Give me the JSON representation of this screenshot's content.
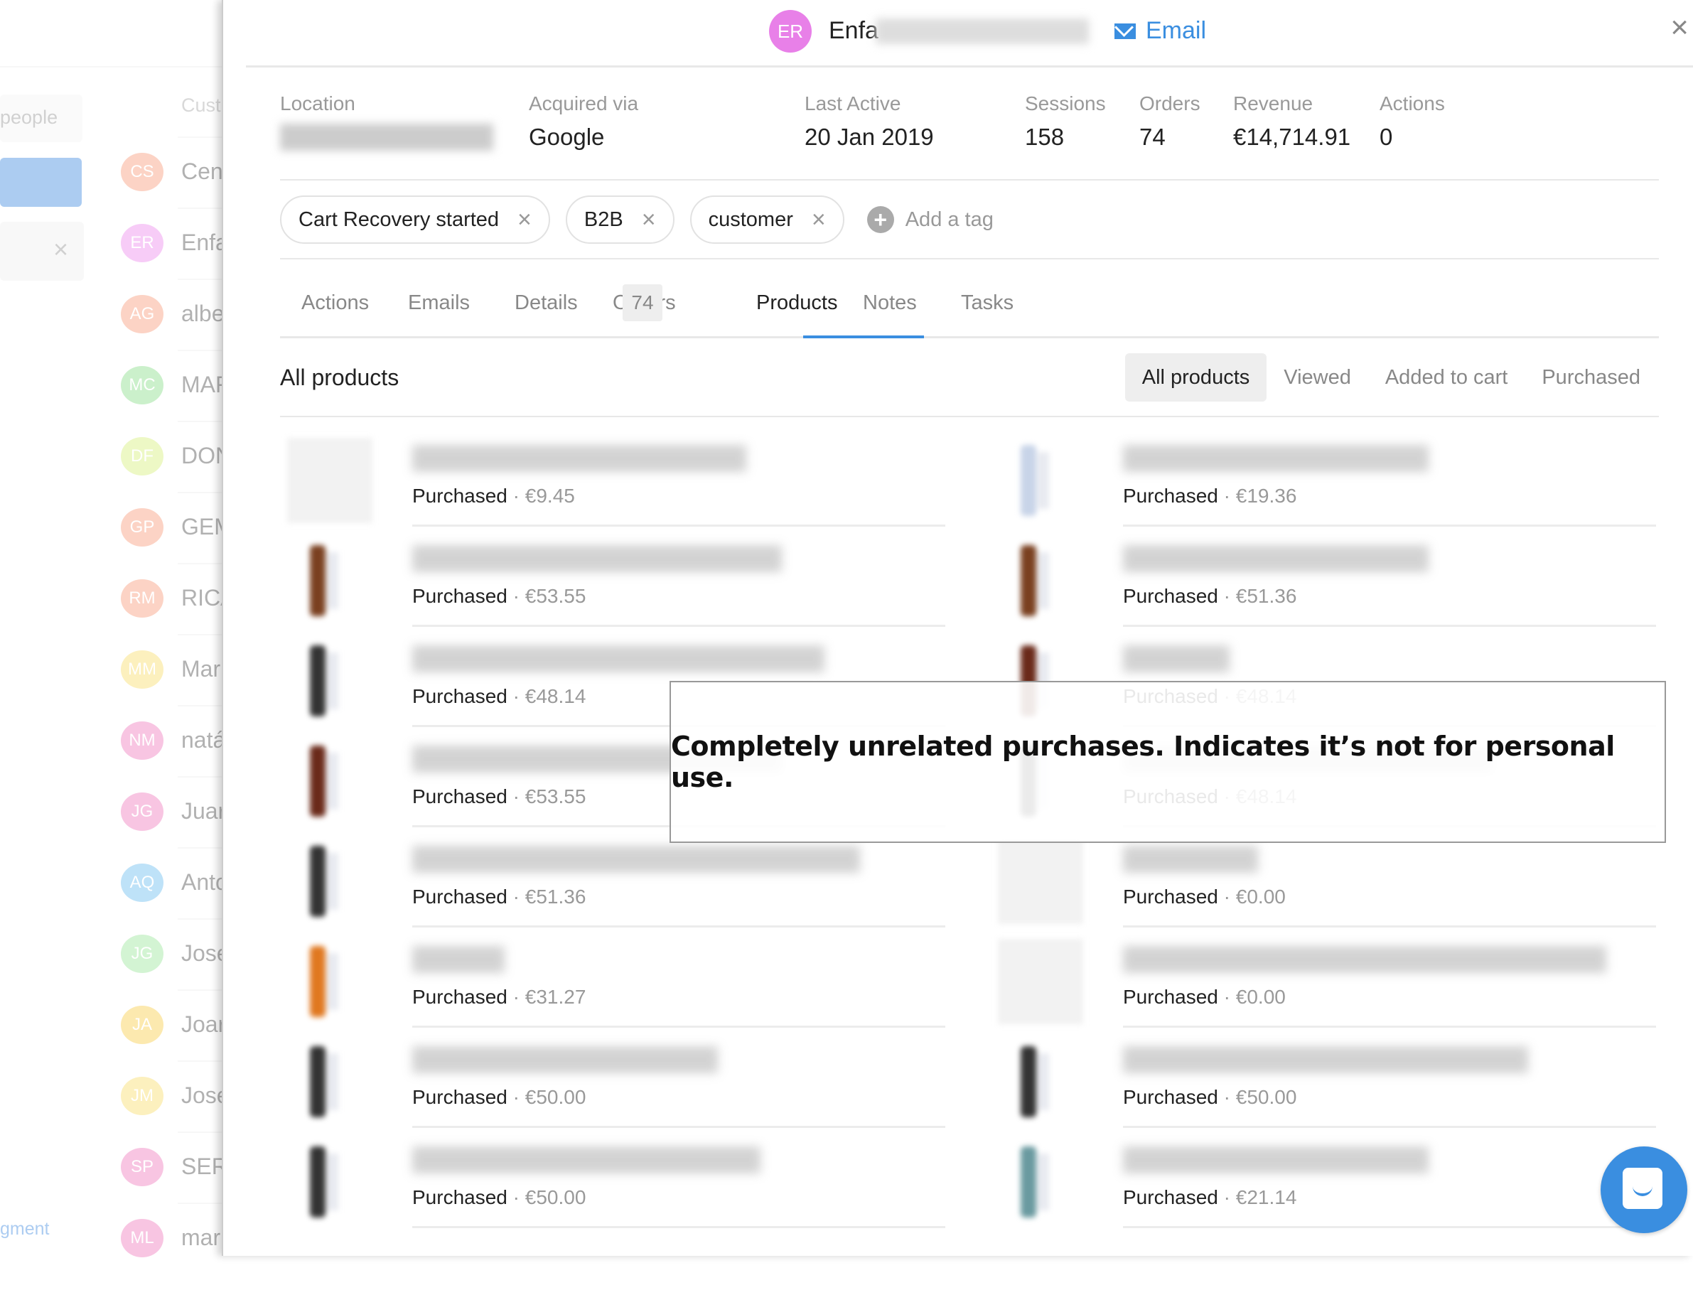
{
  "background_list": {
    "search_placeholder": "people",
    "column_header": "Cust",
    "filter_close": "×",
    "footer_link": "gment",
    "rows": [
      {
        "initials": "CS",
        "name": "Cen",
        "color": "#f9a07f"
      },
      {
        "initials": "ER",
        "name": "Enfa",
        "color": "#ee90ee"
      },
      {
        "initials": "AG",
        "name": "albe",
        "color": "#f9a07f"
      },
      {
        "initials": "MC",
        "name": "MAF",
        "color": "#8ee08e"
      },
      {
        "initials": "DF",
        "name": "DON",
        "color": "#d8f080"
      },
      {
        "initials": "GP",
        "name": "GEM",
        "color": "#f9a07f"
      },
      {
        "initials": "RM",
        "name": "RICA",
        "color": "#f9a07f"
      },
      {
        "initials": "MM",
        "name": "Mar",
        "color": "#fae070"
      },
      {
        "initials": "NM",
        "name": "natá",
        "color": "#f080c0"
      },
      {
        "initials": "JG",
        "name": "Juar",
        "color": "#f080c0"
      },
      {
        "initials": "AQ",
        "name": "Anto",
        "color": "#70c0f0"
      },
      {
        "initials": "JG",
        "name": "Jose",
        "color": "#a0e8a0"
      },
      {
        "initials": "JA",
        "name": "Joar",
        "color": "#fad050"
      },
      {
        "initials": "JM",
        "name": "Jose",
        "color": "#fae070"
      },
      {
        "initials": "SP",
        "name": "SER",
        "color": "#f080c0"
      },
      {
        "initials": "ML",
        "name": "mar",
        "color": "#f080c0"
      }
    ]
  },
  "header": {
    "avatar_initials": "ER",
    "name_visible": "Enfa",
    "email_label": "Email",
    "close": "×"
  },
  "stats": [
    {
      "label": "Location",
      "value": "",
      "blurred": true
    },
    {
      "label": "Acquired via",
      "value": "Google"
    },
    {
      "label": "Last Active",
      "value": "20 Jan 2019"
    },
    {
      "label": "Sessions",
      "value": "158"
    },
    {
      "label": "Orders",
      "value": "74"
    },
    {
      "label": "Revenue",
      "value": "€14,714.91"
    },
    {
      "label": "Actions",
      "value": "0"
    }
  ],
  "tags": [
    {
      "label": "Cart Recovery started",
      "remove": "×"
    },
    {
      "label": "B2B",
      "remove": "×"
    },
    {
      "label": "customer",
      "remove": "×"
    }
  ],
  "add_tag": {
    "icon": "+",
    "label": "Add a tag"
  },
  "tabs": [
    {
      "label": "Actions"
    },
    {
      "label": "Emails"
    },
    {
      "label": "Details"
    },
    {
      "label": "Orders",
      "badge": "74"
    },
    {
      "label": "Products",
      "active": true
    },
    {
      "label": "Notes"
    },
    {
      "label": "Tasks"
    }
  ],
  "products_section": {
    "title": "All products",
    "filters": [
      {
        "label": "All products",
        "active": true
      },
      {
        "label": "Viewed"
      },
      {
        "label": "Added to cart"
      },
      {
        "label": "Purchased"
      }
    ]
  },
  "products": [
    {
      "status": "Purchased",
      "price": "€9.45",
      "thumb": "placeholder"
    },
    {
      "status": "Purchased",
      "price": "€19.36",
      "thumb": "bottle-blue"
    },
    {
      "status": "Purchased",
      "price": "€53.55",
      "thumb": "bottle-brown"
    },
    {
      "status": "Purchased",
      "price": "€51.36",
      "thumb": "bottle-brown"
    },
    {
      "status": "Purchased",
      "price": "€48.14",
      "thumb": "bottle-dark"
    },
    {
      "status": "Purchased",
      "price": "€48.14",
      "thumb": "bottle-red"
    },
    {
      "status": "Purchased",
      "price": "€53.55",
      "thumb": "bottle-red"
    },
    {
      "status": "Purchased",
      "price": "€48.14",
      "thumb": "bottle-dark"
    },
    {
      "status": "Purchased",
      "price": "€51.36",
      "thumb": "bottle-dark"
    },
    {
      "status": "Purchased",
      "price": "€0.00",
      "thumb": "placeholder"
    },
    {
      "status": "Purchased",
      "price": "€31.27",
      "thumb": "bottle-orange"
    },
    {
      "status": "Purchased",
      "price": "€0.00",
      "thumb": "placeholder"
    },
    {
      "status": "Purchased",
      "price": "€50.00",
      "thumb": "bottle-dark"
    },
    {
      "status": "Purchased",
      "price": "€50.00",
      "thumb": "bottle-dark"
    },
    {
      "status": "Purchased",
      "price": "€50.00",
      "thumb": "bottle-dark"
    },
    {
      "status": "Purchased",
      "price": "€21.14",
      "thumb": "bottle-teal"
    }
  ],
  "annotation": "Completely unrelated purchases. Indicates it’s not for personal use."
}
